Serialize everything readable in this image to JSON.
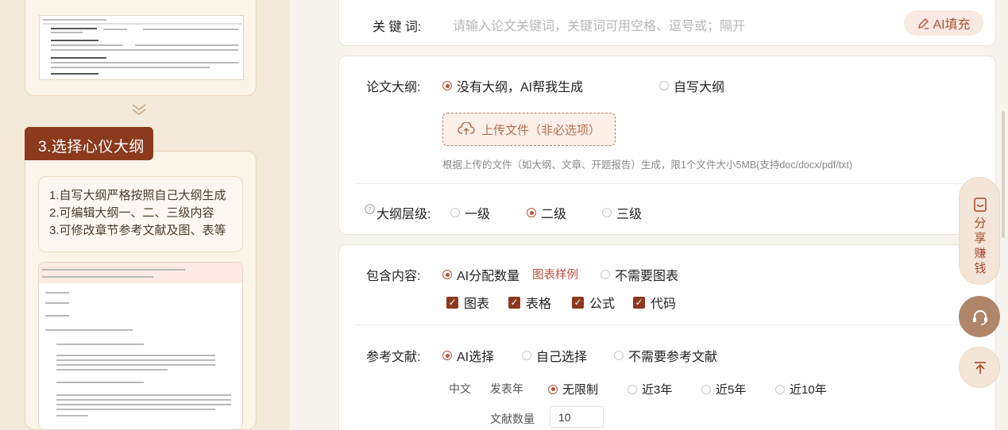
{
  "sidebar": {
    "step_title": "3.选择心仪大纲",
    "features": [
      "1.自写大纲严格按照自己大纲生成",
      "2.可编辑大纲一、二、三级内容",
      "3.可修改章节参考文献及图、表等"
    ]
  },
  "keywords": {
    "label": "关 键 词:",
    "placeholder": "请输入论文关键词，关键词可用空格、逗号或；隔开",
    "ai_fill": "AI填充"
  },
  "outline": {
    "label": "论文大纲:",
    "option_ai": "没有大纲，AI帮我生成",
    "option_self": "自写大纲",
    "upload": "上传文件（非必选项）",
    "upload_hint": "根据上传的文件（如大纲、文章、开题报告）生成，限1个文件大小5MB(支持doc/docx/pdf/txt)",
    "level_label": "大纲层级:",
    "levels": [
      "一级",
      "二级",
      "三级"
    ]
  },
  "content": {
    "label": "包含内容:",
    "option_ai": "AI分配数量",
    "sample_link": "图表样例",
    "option_none": "不需要图表",
    "checks": [
      "图表",
      "表格",
      "公式",
      "代码"
    ]
  },
  "refs": {
    "label": "参考文献:",
    "options": [
      "AI选择",
      "自己选择",
      "不需要参考文献"
    ],
    "lang": "中文",
    "year_label": "发表年",
    "years": [
      "无限制",
      "近3年",
      "近5年",
      "近10年"
    ],
    "count_label": "文献数量",
    "count_value": "10"
  },
  "floating": {
    "share": [
      "分",
      "享",
      "赚",
      "钱"
    ]
  },
  "colors": {
    "accent": "#8b3a1e",
    "radio": "#b4523a",
    "link": "#b4523a"
  }
}
